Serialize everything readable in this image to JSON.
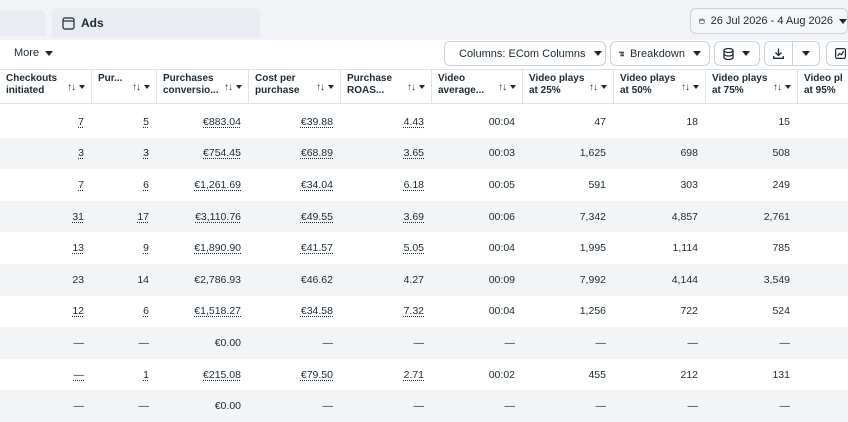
{
  "header": {
    "tab_title": "Ads",
    "date_range": "26 Jul 2026 - 4 Aug 2026"
  },
  "toolbar": {
    "more_label": "More",
    "columns_label": "Columns: ECom Columns",
    "breakdown_label": "Breakdown"
  },
  "table": {
    "columns": [
      {
        "l1": "Checkouts",
        "l2": "initiated"
      },
      {
        "l1": "Pur...",
        "l2": ""
      },
      {
        "l1": "Purchases",
        "l2": "conversio..."
      },
      {
        "l1": "Cost per",
        "l2": "purchase"
      },
      {
        "l1": "Purchase",
        "l2": "ROAS..."
      },
      {
        "l1": "Video",
        "l2": "average..."
      },
      {
        "l1": "Video plays",
        "l2": "at 25%"
      },
      {
        "l1": "Video plays",
        "l2": "at 50%"
      },
      {
        "l1": "Video plays",
        "l2": "at 75%"
      },
      {
        "l1": "Video pl",
        "l2": "at 95%"
      }
    ],
    "rows": [
      [
        "7",
        "5",
        "€883.04",
        "€39.88",
        "4.43",
        "00:04",
        "47",
        "18",
        "15",
        ""
      ],
      [
        "3",
        "3",
        "€754.45",
        "€68.89",
        "3.65",
        "00:03",
        "1,625",
        "698",
        "508",
        ""
      ],
      [
        "7",
        "6",
        "€1,261.69",
        "€34.04",
        "6.18",
        "00:05",
        "591",
        "303",
        "249",
        ""
      ],
      [
        "31",
        "17",
        "€3,110.76",
        "€49.55",
        "3.69",
        "00:06",
        "7,342",
        "4,857",
        "2,761",
        ""
      ],
      [
        "13",
        "9",
        "€1,890.90",
        "€41.57",
        "5.05",
        "00:04",
        "1,995",
        "1,114",
        "785",
        ""
      ],
      [
        "23",
        "14",
        "€2,786.93",
        "€46.62",
        "4.27",
        "00:09",
        "7,992",
        "4,144",
        "3,549",
        ""
      ],
      [
        "12",
        "6",
        "€1,518.27",
        "€34.58",
        "7.32",
        "00:04",
        "1,256",
        "722",
        "524",
        ""
      ],
      [
        "—",
        "—",
        "€0.00",
        "—",
        "—",
        "—",
        "—",
        "—",
        "—",
        ""
      ],
      [
        "—",
        "1",
        "€215.08",
        "€79.50",
        "2.71",
        "00:02",
        "455",
        "212",
        "131",
        ""
      ],
      [
        "—",
        "—",
        "€0.00",
        "—",
        "—",
        "—",
        "—",
        "—",
        "—",
        ""
      ]
    ],
    "underlined_rows": [
      0,
      1,
      2,
      3,
      4,
      6,
      8
    ]
  }
}
